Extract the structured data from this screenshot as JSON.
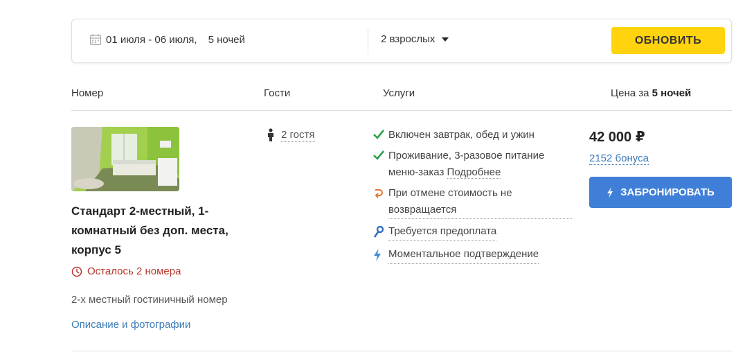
{
  "search": {
    "dates": "01 июля - 06 июля,",
    "nights": "5 ночей",
    "guests": "2 взрослых",
    "update_label": "ОБНОВИТЬ"
  },
  "table_header": {
    "room": "Номер",
    "guests": "Гости",
    "services": "Услуги",
    "price_prefix": "Цена за ",
    "price_nights": "5 ночей"
  },
  "room": {
    "name": "Стандарт 2-местный, 1-комнатный без доп. места, корпус 5",
    "rooms_left": "Осталось 2 номера",
    "description": "2-х местный гостиничный номер",
    "details_link": "Описание и фотографии",
    "guests": "2 гостя"
  },
  "services": [
    {
      "icon": "check-icon",
      "text": "Включен завтрак, обед и ужин"
    },
    {
      "icon": "check-icon",
      "text": "Проживание, 3-разовое питание меню-заказ",
      "link": "Подробнее"
    },
    {
      "icon": "cancel-policy-icon",
      "text": "При отмене стоимость не возвращается"
    },
    {
      "icon": "key-icon",
      "text": "Требуется предоплата"
    },
    {
      "icon": "lightning-icon",
      "text": "Моментальное подтверждение"
    }
  ],
  "price": {
    "amount": "42 000 ₽",
    "bonus": "2152 бонуса",
    "book_label": "ЗАБРОНИРОВАТЬ"
  },
  "colors": {
    "accent_yellow": "#ffd30d",
    "book_blue": "#3f7fd8",
    "link_blue": "#3a7ab8",
    "warning_red": "#b5352a",
    "check_green": "#2aa14a"
  }
}
